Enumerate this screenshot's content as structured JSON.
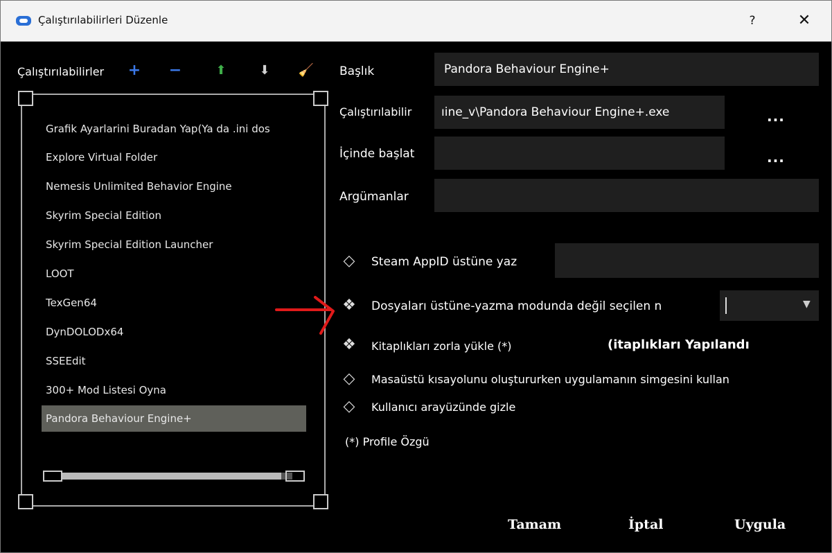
{
  "window": {
    "title": "Çalıştırılabilirleri Düzenle",
    "help_label": "?",
    "close_label": "✕"
  },
  "left": {
    "title": "Çalıştırılabilirler",
    "toolbar": {
      "add": "+",
      "remove": "−",
      "up": "⬆",
      "down": "⬇",
      "clean": "🧹"
    },
    "items": [
      "Grafik Ayarlarini Buradan Yap(Ya da .ini dos",
      "Explore Virtual Folder",
      "Nemesis Unlimited Behavior Engine",
      "Skyrim Special Edition",
      "Skyrim Special Edition Launcher",
      "LOOT",
      "TexGen64",
      "DynDOLODx64",
      "SSEEdit",
      "300+ Mod Listesi Oyna",
      "Pandora Behaviour Engine+"
    ],
    "selected_index": 10
  },
  "form": {
    "title_label": "Başlık",
    "title_value": "Pandora Behaviour Engine+",
    "exe_label": "Çalıştırılabilir",
    "exe_value": "ıine_v\\Pandora Behaviour Engine+.exe",
    "start_in_label": "İçinde başlat",
    "start_in_value": "",
    "args_label": "Argümanlar",
    "args_value": "",
    "browse_label": "...",
    "browse2_label": "..."
  },
  "options": {
    "steam_label": "Steam AppID üstüne yaz",
    "steam_value": "",
    "overwrite_label": "Dosyaları üstüne-yazma modunda değil seçilen n",
    "libraries_label": "Kitaplıkları zorla yükle (*)",
    "libraries_button": "(itaplıkları Yapılandı",
    "desktop_label": "Masaüstü kısayolunu oluştururken uygulamanın simgesini kullan",
    "hide_label": "Kullanıcı arayüzünde gizle",
    "profile_note": "(*) Profile Özgü"
  },
  "buttons": {
    "ok": "Tamam",
    "cancel": "İptal",
    "apply": "Uygula"
  },
  "colors": {
    "background": "#000000",
    "field": "#1f1f1f",
    "selected_item": "#5f605a",
    "annotation_arrow": "#e01a1a",
    "toolbar_add": "#3b78e7",
    "toolbar_remove": "#3b78e7",
    "toolbar_up": "#3fae49",
    "toolbar_down": "#d0d0d0"
  }
}
